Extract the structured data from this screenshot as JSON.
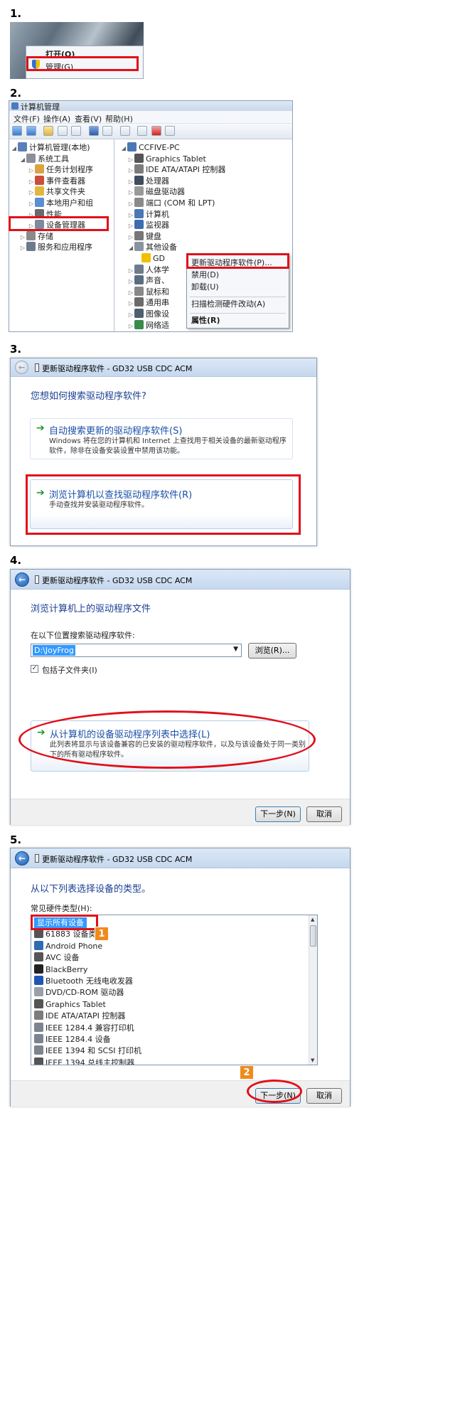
{
  "steps": [
    "1.",
    "2.",
    "3.",
    "4.",
    "5."
  ],
  "step1": {
    "menu": [
      "打开(O)",
      "管理(G)"
    ]
  },
  "step2": {
    "window_title": "计算机管理",
    "menubar": [
      "文件(F)",
      "操作(A)",
      "查看(V)",
      "帮助(H)"
    ],
    "left_tree": [
      {
        "label": "计算机管理(本地)",
        "level": 0,
        "icon": "computer-management-icon"
      },
      {
        "label": "系统工具",
        "level": 1,
        "icon": "tools-icon"
      },
      {
        "label": "任务计划程序",
        "level": 2,
        "icon": "clock-icon"
      },
      {
        "label": "事件查看器",
        "level": 2,
        "icon": "event-icon"
      },
      {
        "label": "共享文件夹",
        "level": 2,
        "icon": "folder-icon"
      },
      {
        "label": "本地用户和组",
        "level": 2,
        "icon": "users-icon"
      },
      {
        "label": "性能",
        "level": 2,
        "icon": "performance-icon"
      },
      {
        "label": "设备管理器",
        "level": 2,
        "icon": "device-manager-icon"
      },
      {
        "label": "存储",
        "level": 1,
        "icon": "storage-icon"
      },
      {
        "label": "服务和应用程序",
        "level": 1,
        "icon": "services-icon"
      }
    ],
    "right_tree": [
      {
        "label": "CCFIVE-PC",
        "level": 0,
        "icon": "computer-icon"
      },
      {
        "label": "Graphics Tablet",
        "level": 1,
        "icon": "tablet-icon"
      },
      {
        "label": "IDE ATA/ATAPI 控制器",
        "level": 1,
        "icon": "ide-icon"
      },
      {
        "label": "处理器",
        "level": 1,
        "icon": "cpu-icon"
      },
      {
        "label": "磁盘驱动器",
        "level": 1,
        "icon": "disk-icon"
      },
      {
        "label": "端口 (COM 和 LPT)",
        "level": 1,
        "icon": "port-icon"
      },
      {
        "label": "计算机",
        "level": 1,
        "icon": "computer-icon"
      },
      {
        "label": "监视器",
        "level": 1,
        "icon": "monitor-icon"
      },
      {
        "label": "键盘",
        "level": 1,
        "icon": "keyboard-icon"
      },
      {
        "label": "其他设备",
        "level": 1,
        "icon": "other-device-icon"
      },
      {
        "label": "GD",
        "level": 2,
        "icon": "warning-icon"
      },
      {
        "label": "人体学",
        "level": 1,
        "icon": "hid-icon"
      },
      {
        "label": "声音、",
        "level": 1,
        "icon": "sound-icon"
      },
      {
        "label": "鼠标和",
        "level": 1,
        "icon": "mouse-icon"
      },
      {
        "label": "通用串",
        "level": 1,
        "icon": "usb-icon"
      },
      {
        "label": "图像设",
        "level": 1,
        "icon": "camera-icon"
      },
      {
        "label": "网络适",
        "level": 1,
        "icon": "network-icon"
      }
    ],
    "context_menu": [
      "更新驱动程序软件(P)...",
      "禁用(D)",
      "卸载(U)",
      "扫描检测硬件改动(A)",
      "属性(R)"
    ]
  },
  "dialog_title": "更新驱动程序软件 - GD32 USB CDC ACM",
  "step3": {
    "heading": "您想如何搜索驱动程序软件?",
    "option1_title": "自动搜索更新的驱动程序软件(S)",
    "option1_desc": "Windows 将在您的计算机和 Internet 上查找用于相关设备的最新驱动程序软件，除非在设备安装设置中禁用该功能。",
    "option2_title": "浏览计算机以查找驱动程序软件(R)",
    "option2_desc": "手动查找并安装驱动程序软件。"
  },
  "step4": {
    "heading": "浏览计算机上的驱动程序文件",
    "search_label": "在以下位置搜索驱动程序软件:",
    "path_value": "D:\\JoyFrog",
    "browse_label": "浏览(R)...",
    "include_subfolders": "包括子文件夹(I)",
    "option_title": "从计算机的设备驱动程序列表中选择(L)",
    "option_desc": "此列表将显示与该设备兼容的已安装的驱动程序软件，以及与该设备处于同一类别下的所有驱动程序软件。",
    "next_label": "下一步(N)",
    "cancel_label": "取消"
  },
  "step5": {
    "heading": "从以下列表选择设备的类型。",
    "list_label": "常见硬件类型(H):",
    "items": [
      {
        "label": "显示所有设备",
        "icon": "",
        "selected": true
      },
      {
        "label": "61883 设备类",
        "icon": "device-icon"
      },
      {
        "label": "Android Phone",
        "icon": "phone-icon"
      },
      {
        "label": "AVC 设备",
        "icon": "device-icon"
      },
      {
        "label": "BlackBerry",
        "icon": "blackberry-icon"
      },
      {
        "label": "Bluetooth 无线电收发器",
        "icon": "bluetooth-icon"
      },
      {
        "label": "DVD/CD-ROM 驱动器",
        "icon": "dvd-icon"
      },
      {
        "label": "Graphics Tablet",
        "icon": "tablet-icon"
      },
      {
        "label": "IDE ATA/ATAPI 控制器",
        "icon": "ide-icon"
      },
      {
        "label": "IEEE 1284.4 兼容打印机",
        "icon": "printer-icon"
      },
      {
        "label": "IEEE 1284.4 设备",
        "icon": "printer-icon"
      },
      {
        "label": "IEEE 1394 和 SCSI 打印机",
        "icon": "printer-icon"
      },
      {
        "label": "IEEE 1394 总线主控制器",
        "icon": "device-icon"
      }
    ],
    "badge1": "1",
    "badge2": "2",
    "next_label": "下一步(N)",
    "cancel_label": "取消"
  },
  "colors": {
    "accent_red": "#e0101a",
    "badge_orange": "#f08a1c",
    "link_blue": "#1a4fa8",
    "selection_blue": "#3399ff"
  }
}
